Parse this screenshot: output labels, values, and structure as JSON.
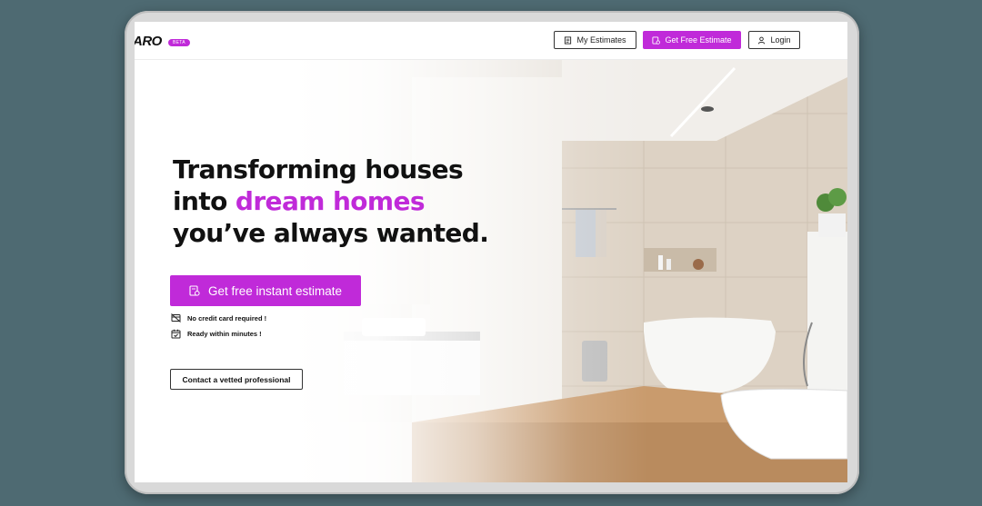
{
  "header": {
    "logo": "ARO",
    "beta_badge": "BETA",
    "my_estimates_label": "My Estimates",
    "get_free_estimate_label": "Get Free Estimate",
    "login_label": "Login"
  },
  "hero": {
    "headline_line1": "Transforming houses",
    "headline_line2_prefix": "into ",
    "headline_line2_accent": "dream homes",
    "headline_line3": "you’ve always wanted.",
    "cta_label": "Get free instant estimate",
    "features": [
      {
        "text": "No credit card required !",
        "icon": "no-card-icon"
      },
      {
        "text": "Ready within minutes !",
        "icon": "calendar-check-icon"
      }
    ],
    "contact_label": "Contact a vetted professional"
  },
  "colors": {
    "accent": "#c02ad9",
    "frame_background": "#4e6a72"
  }
}
